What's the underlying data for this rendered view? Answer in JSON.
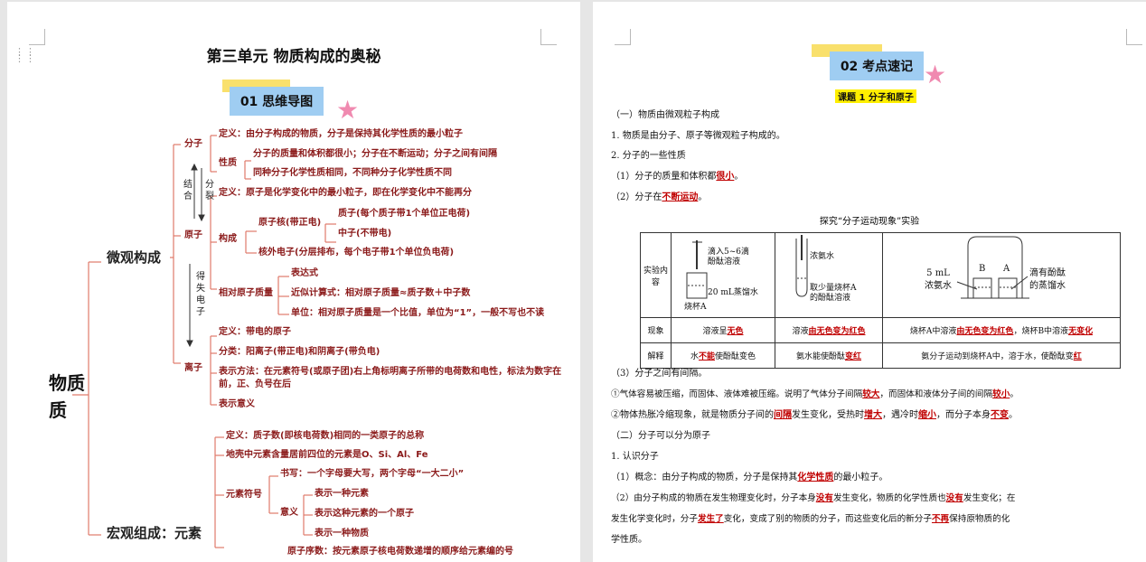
{
  "left_page": {
    "title": "第三单元      物质构成的奥秘",
    "section_tag": "01    思维导图",
    "mindmap": {
      "root": "物质",
      "branch1": "微观构成",
      "branch2": "宏观组成：元素",
      "side_labels": {
        "combine": "结合",
        "split": "分裂",
        "gain_lose": "得失电子"
      },
      "molecule": {
        "label": "分子",
        "definition": "定义：由分子构成的物质，分子是保持其化学性质的最小粒子",
        "property_label": "性质",
        "property_1": "分子的质量和体积都很小；分子在不断运动；分子之间有间隔",
        "property_2": "同种分子化学性质相同，不同种分子化学性质不同"
      },
      "atom": {
        "label": "原子",
        "definition": "定义：原子是化学变化中的最小粒子，即在化学变化中不能再分",
        "structure_label": "构成",
        "nucleus": "原子核(带正电)",
        "proton": "质子(每个质子带1个单位正电荷)",
        "neutron": "中子(不带电)",
        "electron": "核外电子(分层排布，每个电子带1个单位负电荷)",
        "mass_label": "相对原子质量",
        "expr": "表达式",
        "approx": "近似计算式：相对原子质量≈质子数＋中子数",
        "unit": "单位：相对原子质量是一个比值，单位为“1”，一般不写也不读"
      },
      "ion": {
        "label": "离子",
        "definition": "定义：带电的原子",
        "classes": "分类：阳离子(带正电)和阴离子(带负电)",
        "notation": "表示方法：在元素符号(或原子团)右上角标明离子所带的电荷数和电性，标法为数字在前，正、负号在后",
        "meaning": "表示意义"
      },
      "element": {
        "definition": "定义：质子数(即核电荷数)相同的一类原子的总称",
        "crust": "地壳中元素含量居前四位的元素是O、Si、Al、Fe",
        "symbol_label": "元素符号",
        "writing_label": "书写：",
        "writing": "一个字母要大写，两个字母“一大二小”",
        "meaning_label": "意义",
        "meaning_1": "表示一种元素",
        "meaning_2": "表示这种元素的一个原子",
        "meaning_3": "表示一种物质",
        "order": "原子序数：按元素原子核电荷数递增的顺序给元素编的号"
      }
    }
  },
  "right_page": {
    "section_tag": "02    考点速记",
    "lesson_tag": "课题 1    分子和原子",
    "lines": {
      "h1": "（一）物质由微观粒子构成",
      "p1": "1. 物质是由分子、原子等微观粒子构成的。",
      "p2": "2. 分子的一些性质",
      "p3a": "（1）分子的质量和体积都",
      "p3b": "很小",
      "p3c": "。",
      "p4a": "（2）分子在",
      "p4b": "不断运动",
      "p4c": "。",
      "caption": "探究“分子运动现象”实验",
      "p5": "（3）分子之间有间隔。",
      "p6a": "①气体容易被压缩，而固体、液体难被压缩。说明了气体分子间隔",
      "p6b": "较大",
      "p6c": "，而固体和液体分子间的间隔",
      "p6d": "较小",
      "p6e": "。",
      "p7a": "②物体热胀冷缩现象，就是物质分子间的",
      "p7b": "间隔",
      "p7c": "发生变化，受热时",
      "p7d": "增大",
      "p7e": "，遇冷时",
      "p7f": "缩小",
      "p7g": "，而分子本身",
      "p7h": "不变",
      "p7i": "。",
      "h2": "（二）分子可以分为原子",
      "p8": "1. 认识分子",
      "p9a": "（1）概念：由分子构成的物质，分子是保持其",
      "p9b": "化学性质",
      "p9c": "的最小粒子。",
      "p10a": "（2）由分子构成的物质在发生物理变化时，分子本身",
      "p10b": "没有",
      "p10c": "发生变化，物质的化学性质也",
      "p10d": "没有",
      "p10e": "发生变化；在",
      "p11a": "发生化学变化时，分子",
      "p11b": "发生了",
      "p11c": "变化，变成了别的物质的分子，而这些变化后的新分子",
      "p11d": "不再",
      "p11e": "保持原物质的化",
      "p12": "学性质。"
    },
    "table": {
      "row1_head": "实验内容",
      "img1_a": "滴入5~6滴",
      "img1_b": "酚酞溶液",
      "img1_c": "20 mL蒸馏水",
      "img1_d": "烧杯A",
      "img2_a": "浓氨水",
      "img2_b": "取少量烧杯A",
      "img2_c": "的酚酞溶液",
      "img3_a": "5 mL",
      "img3_b": "浓氨水",
      "img3_c": "滴有酚酞",
      "img3_d": "的蒸馏水",
      "beaker_b": "B",
      "beaker_a": "A",
      "row2_head": "现象",
      "r2c1a": "溶液呈",
      "r2c1b": "无色",
      "r2c2a": "溶液",
      "r2c2b": "由无色变为红色",
      "r2c3a": "烧杯A中溶液",
      "r2c3b": "由无色变为红色",
      "r2c3c": "，烧杯B中溶液",
      "r2c3d": "无变化",
      "row3_head": "解释",
      "r3c1a": "水",
      "r3c1b": "不能",
      "r3c1c": "使酚酞变色",
      "r3c2a": "氨水能使酚酞",
      "r3c2b": "变红",
      "r3c3a": "氨分子运动到烧杯A中，溶于水，使酚酞变",
      "r3c3b": "红"
    }
  },
  "colors": {
    "mindmap_text": "#8b1a1a",
    "line": "#e07a6a",
    "tag_blue": "#9fcdf2",
    "tag_yellow": "#f9e06c",
    "answer": "#c00000"
  }
}
